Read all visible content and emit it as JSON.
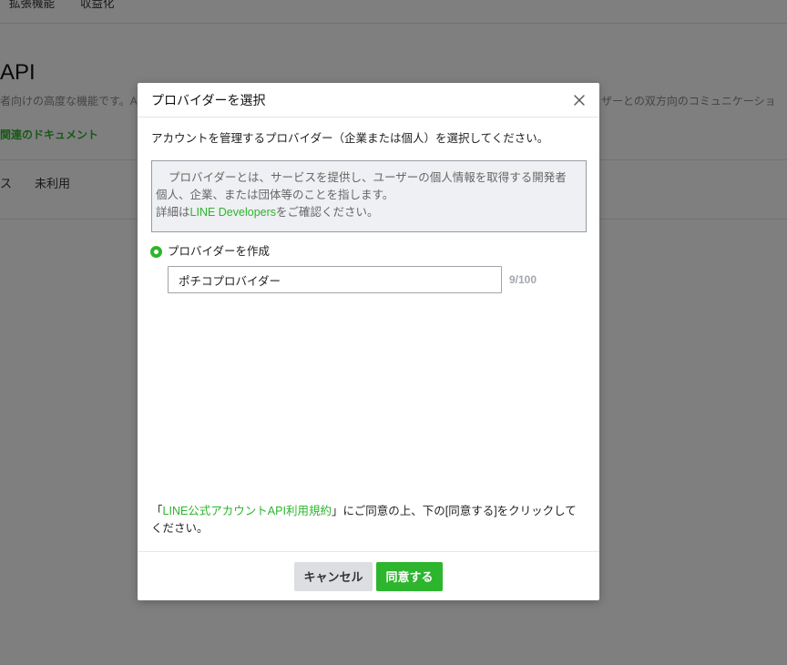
{
  "page": {
    "nav": {
      "items": [
        {
          "label": "拡張機能"
        },
        {
          "label": "収益化"
        }
      ]
    },
    "title": "API",
    "subtitle_left": "者向けの高度な機能です。A",
    "subtitle_right": "ザーとの双方向のコミュニケーショ",
    "docs_link": "関連のドキュメント",
    "status": {
      "label": "ス",
      "value": "未利用"
    }
  },
  "modal": {
    "title": "プロバイダーを選択",
    "close_icon": "close-icon",
    "description": "アカウントを管理するプロバイダー（企業または個人）を選択してください。",
    "info": {
      "lines": [
        "プロバイダーとは、サービスを提供し、ユーザーの個人情報を取得する開発者",
        "個人、企業、または団体等のことを指します。"
      ],
      "detail_prefix": "詳細は",
      "detail_link": "LINE Developers",
      "detail_suffix": "をご確認ください。"
    },
    "option": {
      "label": "プロバイダーを作成",
      "selected": true
    },
    "input": {
      "value": "ポチコプロバイダー",
      "caret_index": 3,
      "counter": "9/100"
    },
    "terms": {
      "open": "「",
      "link": "LINE公式アカウントAPI利用規約",
      "rest": "」にご同意の上、下の[同意する]をクリックしてください。"
    },
    "buttons": {
      "cancel": "キャンセル",
      "agree": "同意する"
    }
  },
  "colors": {
    "accent": "#2db52d"
  }
}
